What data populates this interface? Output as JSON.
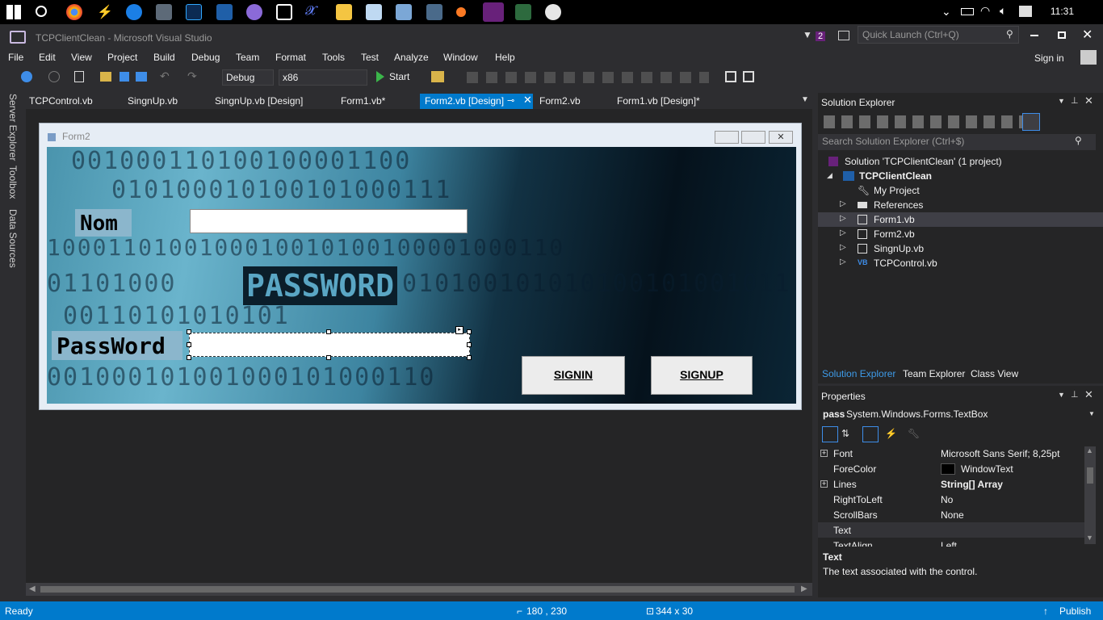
{
  "taskbar": {
    "clock": "11:31"
  },
  "window": {
    "title": "TCPClientClean - Microsoft Visual Studio",
    "notif_count": "2",
    "quick_launch_placeholder": "Quick Launch (Ctrl+Q)",
    "sign_in": "Sign in"
  },
  "menu": [
    "File",
    "Edit",
    "View",
    "Project",
    "Build",
    "Debug",
    "Team",
    "Format",
    "Tools",
    "Test",
    "Analyze",
    "Window",
    "Help"
  ],
  "toolbar": {
    "config": "Debug",
    "platform": "x86",
    "start": "Start"
  },
  "tabs": [
    "TCPControl.vb",
    "SingnUp.vb",
    "SingnUp.vb [Design]",
    "Form1.vb*",
    "Form2.vb [Design]",
    "Form2.vb",
    "Form1.vb [Design]*"
  ],
  "side_rail": [
    "Server Explorer",
    "Toolbox",
    "Data Sources"
  ],
  "designer": {
    "form_title": "Form2",
    "watermark_text": "PASSWORD",
    "nom_label": "Nom",
    "password_label": "PassWord",
    "signin_button": "SIGNIN",
    "signup_button": "SIGNUP",
    "binary_rows": [
      "001000110100100001100",
      "010100010100101000111",
      "1000110100100010010100100001000110",
      "01101000",
      "010100101010100101001011",
      "00110101010101",
      "001000101001000101000110"
    ]
  },
  "solution_explorer": {
    "title": "Solution Explorer",
    "search_placeholder": "Search Solution Explorer (Ctrl+$)",
    "items": [
      "Solution 'TCPClientClean' (1 project)",
      "TCPClientClean",
      "My Project",
      "References",
      "Form1.vb",
      "Form2.vb",
      "SingnUp.vb",
      "TCPControl.vb"
    ],
    "bottom_tabs": [
      "Solution Explorer",
      "Team Explorer",
      "Class View"
    ]
  },
  "properties": {
    "title": "Properties",
    "object_name": "pass",
    "object_type": "System.Windows.Forms.TextBox",
    "rows": [
      {
        "name": "Font",
        "value": "Microsoft Sans Serif; 8,25pt"
      },
      {
        "name": "ForeColor",
        "value": "WindowText"
      },
      {
        "name": "Lines",
        "value": "String[] Array"
      },
      {
        "name": "RightToLeft",
        "value": "No"
      },
      {
        "name": "ScrollBars",
        "value": "None"
      },
      {
        "name": "Text",
        "value": ""
      },
      {
        "name": "TextAlign",
        "value": "Left"
      }
    ],
    "desc_title": "Text",
    "desc_body": "The text associated with the control."
  },
  "status": {
    "state": "Ready",
    "position": "180 , 230",
    "size": "344 x 30",
    "publish": "Publish"
  }
}
